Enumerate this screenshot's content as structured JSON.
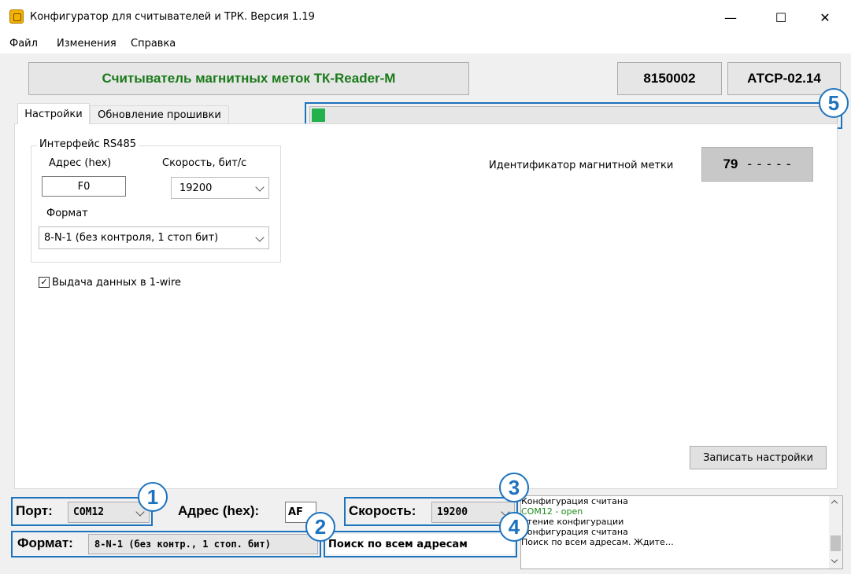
{
  "window": {
    "title": "Конфигуратор  для считывателей и ТРК.  Версия 1.19",
    "minimize": "—",
    "maximize": "☐",
    "close": "✕"
  },
  "menu": [
    "Файл",
    "Изменения",
    "Справка"
  ],
  "header": {
    "device_name": "Считыватель магнитных меток ТК-Reader-M",
    "device_name_color": "#1a7a1a",
    "serial": "8150002",
    "model": "АТСР-02.14"
  },
  "tabs": [
    {
      "label": "Настройки",
      "active": true
    },
    {
      "label": "Обновление прошивки",
      "active": false
    }
  ],
  "progress": {
    "fraction": 0.025,
    "color": "#22b14c"
  },
  "rs485": {
    "group_title": "Интерфейс RS485",
    "address_label": "Адрес (hex)",
    "address_value": "F0",
    "speed_label": "Скорость, бит/с",
    "speed_value": "19200",
    "format_label": "Формат",
    "format_value": "8-N-1 (без контроля, 1 стоп бит)"
  },
  "onewire": {
    "label": "Выдача данных в 1-wire",
    "checked": true,
    "checkmark": "✓"
  },
  "tag": {
    "label": "Идентификатор магнитной метки",
    "value": "79",
    "placeholder": "- - - - -"
  },
  "write_button": "Записать настройки",
  "bottom": {
    "port_label": "Порт:",
    "port_value": "COM12",
    "address_label": "Адрес (hex):",
    "address_value": "AF",
    "speed_label": "Скорость:",
    "speed_value": "19200",
    "format_label": "Формат:",
    "format_value": "8-N-1 (без контр., 1 стоп. бит)",
    "search_value": "Поиск по всем адресам"
  },
  "log": [
    {
      "text": "Конфигурация считана",
      "color": "#000000"
    },
    {
      "text": "COM12 - open",
      "color": "#1a8a1a"
    },
    {
      "text": "Чтение конфигурации",
      "color": "#000000"
    },
    {
      "text": "Конфигурация считана",
      "color": "#000000"
    },
    {
      "text": "Поиск по всем адресам. Ждите…",
      "color": "#000000"
    }
  ],
  "callouts": [
    "1",
    "2",
    "3",
    "4",
    "5"
  ],
  "callout_color": "#1e73be"
}
